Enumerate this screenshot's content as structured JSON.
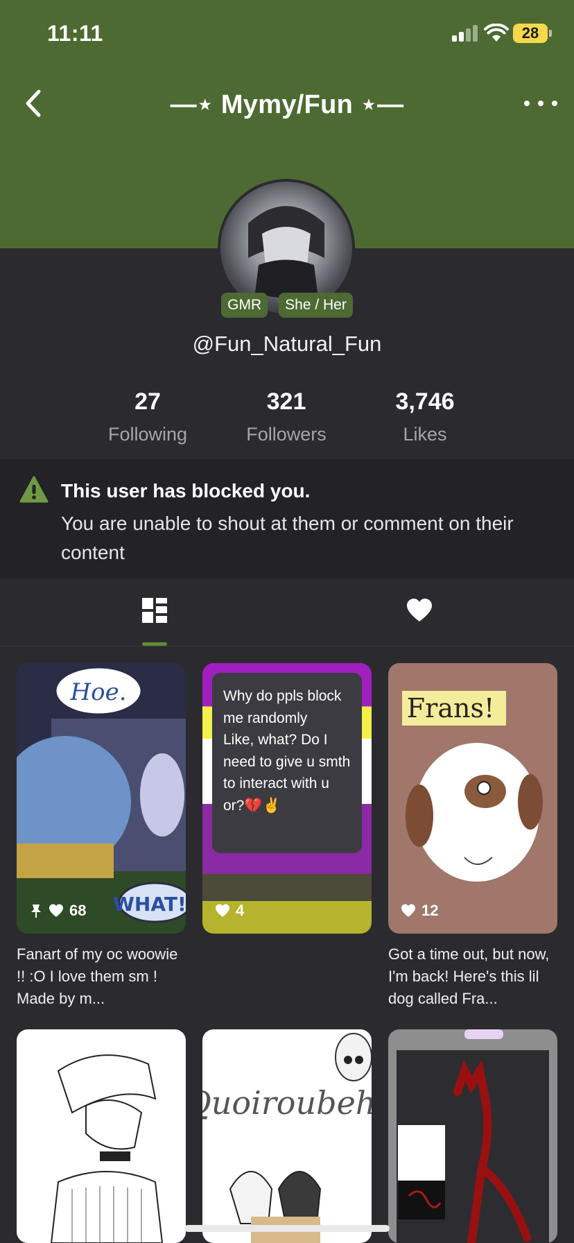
{
  "status_bar": {
    "time": "11:11",
    "battery": "28"
  },
  "nav": {
    "title": "—⋆ Mymy/Fun ⋆—"
  },
  "profile": {
    "badges": [
      "GMR",
      "She / Her"
    ],
    "username": "@Fun_Natural_Fun",
    "stats": [
      {
        "value": "27",
        "label": "Following"
      },
      {
        "value": "321",
        "label": "Followers"
      },
      {
        "value": "3,746",
        "label": "Likes"
      }
    ]
  },
  "blocked": {
    "title": "This user has blocked you.",
    "body": "You are unable to shout at them or comment on their content"
  },
  "posts": [
    {
      "likes": "68",
      "caption": "Fanart of my oc woowie !! :O I love them sm ! Made by m...",
      "art_text": [
        "Hoe.",
        "WHAT!?"
      ]
    },
    {
      "likes": "4",
      "note_text": "Why do ppls block me randomly\nLike, what? Do I need to give u smth to interact with u or?💔✌️"
    },
    {
      "likes": "12",
      "caption": "Got a time out, but now, I'm back! Here's this lil dog called Fra...",
      "art_text": [
        "Frans!"
      ]
    },
    {
      "art_text": []
    },
    {
      "art_text": [
        "Quoiroubeh!"
      ]
    },
    {
      "art_text": []
    }
  ],
  "colors": {
    "header": "#4e6a33",
    "background": "#2b2a2f",
    "accent": "#5f8a3a"
  }
}
